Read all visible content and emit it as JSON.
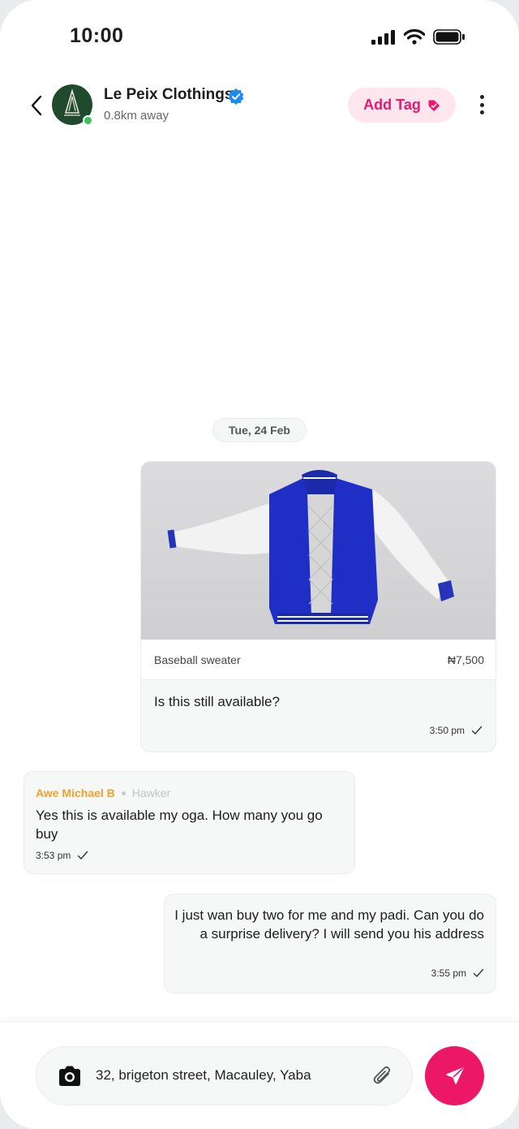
{
  "status_bar": {
    "time": "10:00",
    "icons": [
      "signal-icon",
      "wifi-icon",
      "battery-icon"
    ]
  },
  "header": {
    "shop_name": "Le Peix Clothings",
    "distance": "0.8km away",
    "verified": true,
    "online": true,
    "add_tag_label": "Add Tag",
    "icons": [
      "back-icon",
      "verified-badge-icon",
      "tag-icon",
      "more-vertical-icon"
    ]
  },
  "chat": {
    "date_label": "Tue, 24 Feb",
    "messages": [
      {
        "direction": "outgoing",
        "product": {
          "name": "Baseball sweater",
          "price": "₦7,500",
          "image": "varsity-jacket-image"
        },
        "text": "Is this still available?",
        "time": "3:50 pm",
        "status": "sent"
      },
      {
        "direction": "incoming",
        "sender_name": "Awe Michael B",
        "sender_role": "Hawker",
        "text": "Yes this is available my oga. How many you go buy",
        "time": "3:53 pm",
        "status": "sent"
      },
      {
        "direction": "outgoing",
        "text": "I just wan buy two for me and my padi. Can you do a surprise delivery? I will send you his address",
        "time": "3:55 pm",
        "status": "sent"
      }
    ]
  },
  "composer": {
    "value": "32, brigeton street, Macauley, Yaba",
    "icons": [
      "camera-icon",
      "paperclip-icon",
      "send-icon"
    ]
  },
  "colors": {
    "accent": "#ec1867",
    "tag_bg": "#fde6ee",
    "sender_name": "#f0a22e",
    "online": "#39c15a",
    "verified": "#1d8cf0",
    "bubble_bg": "#f6f7f7"
  }
}
